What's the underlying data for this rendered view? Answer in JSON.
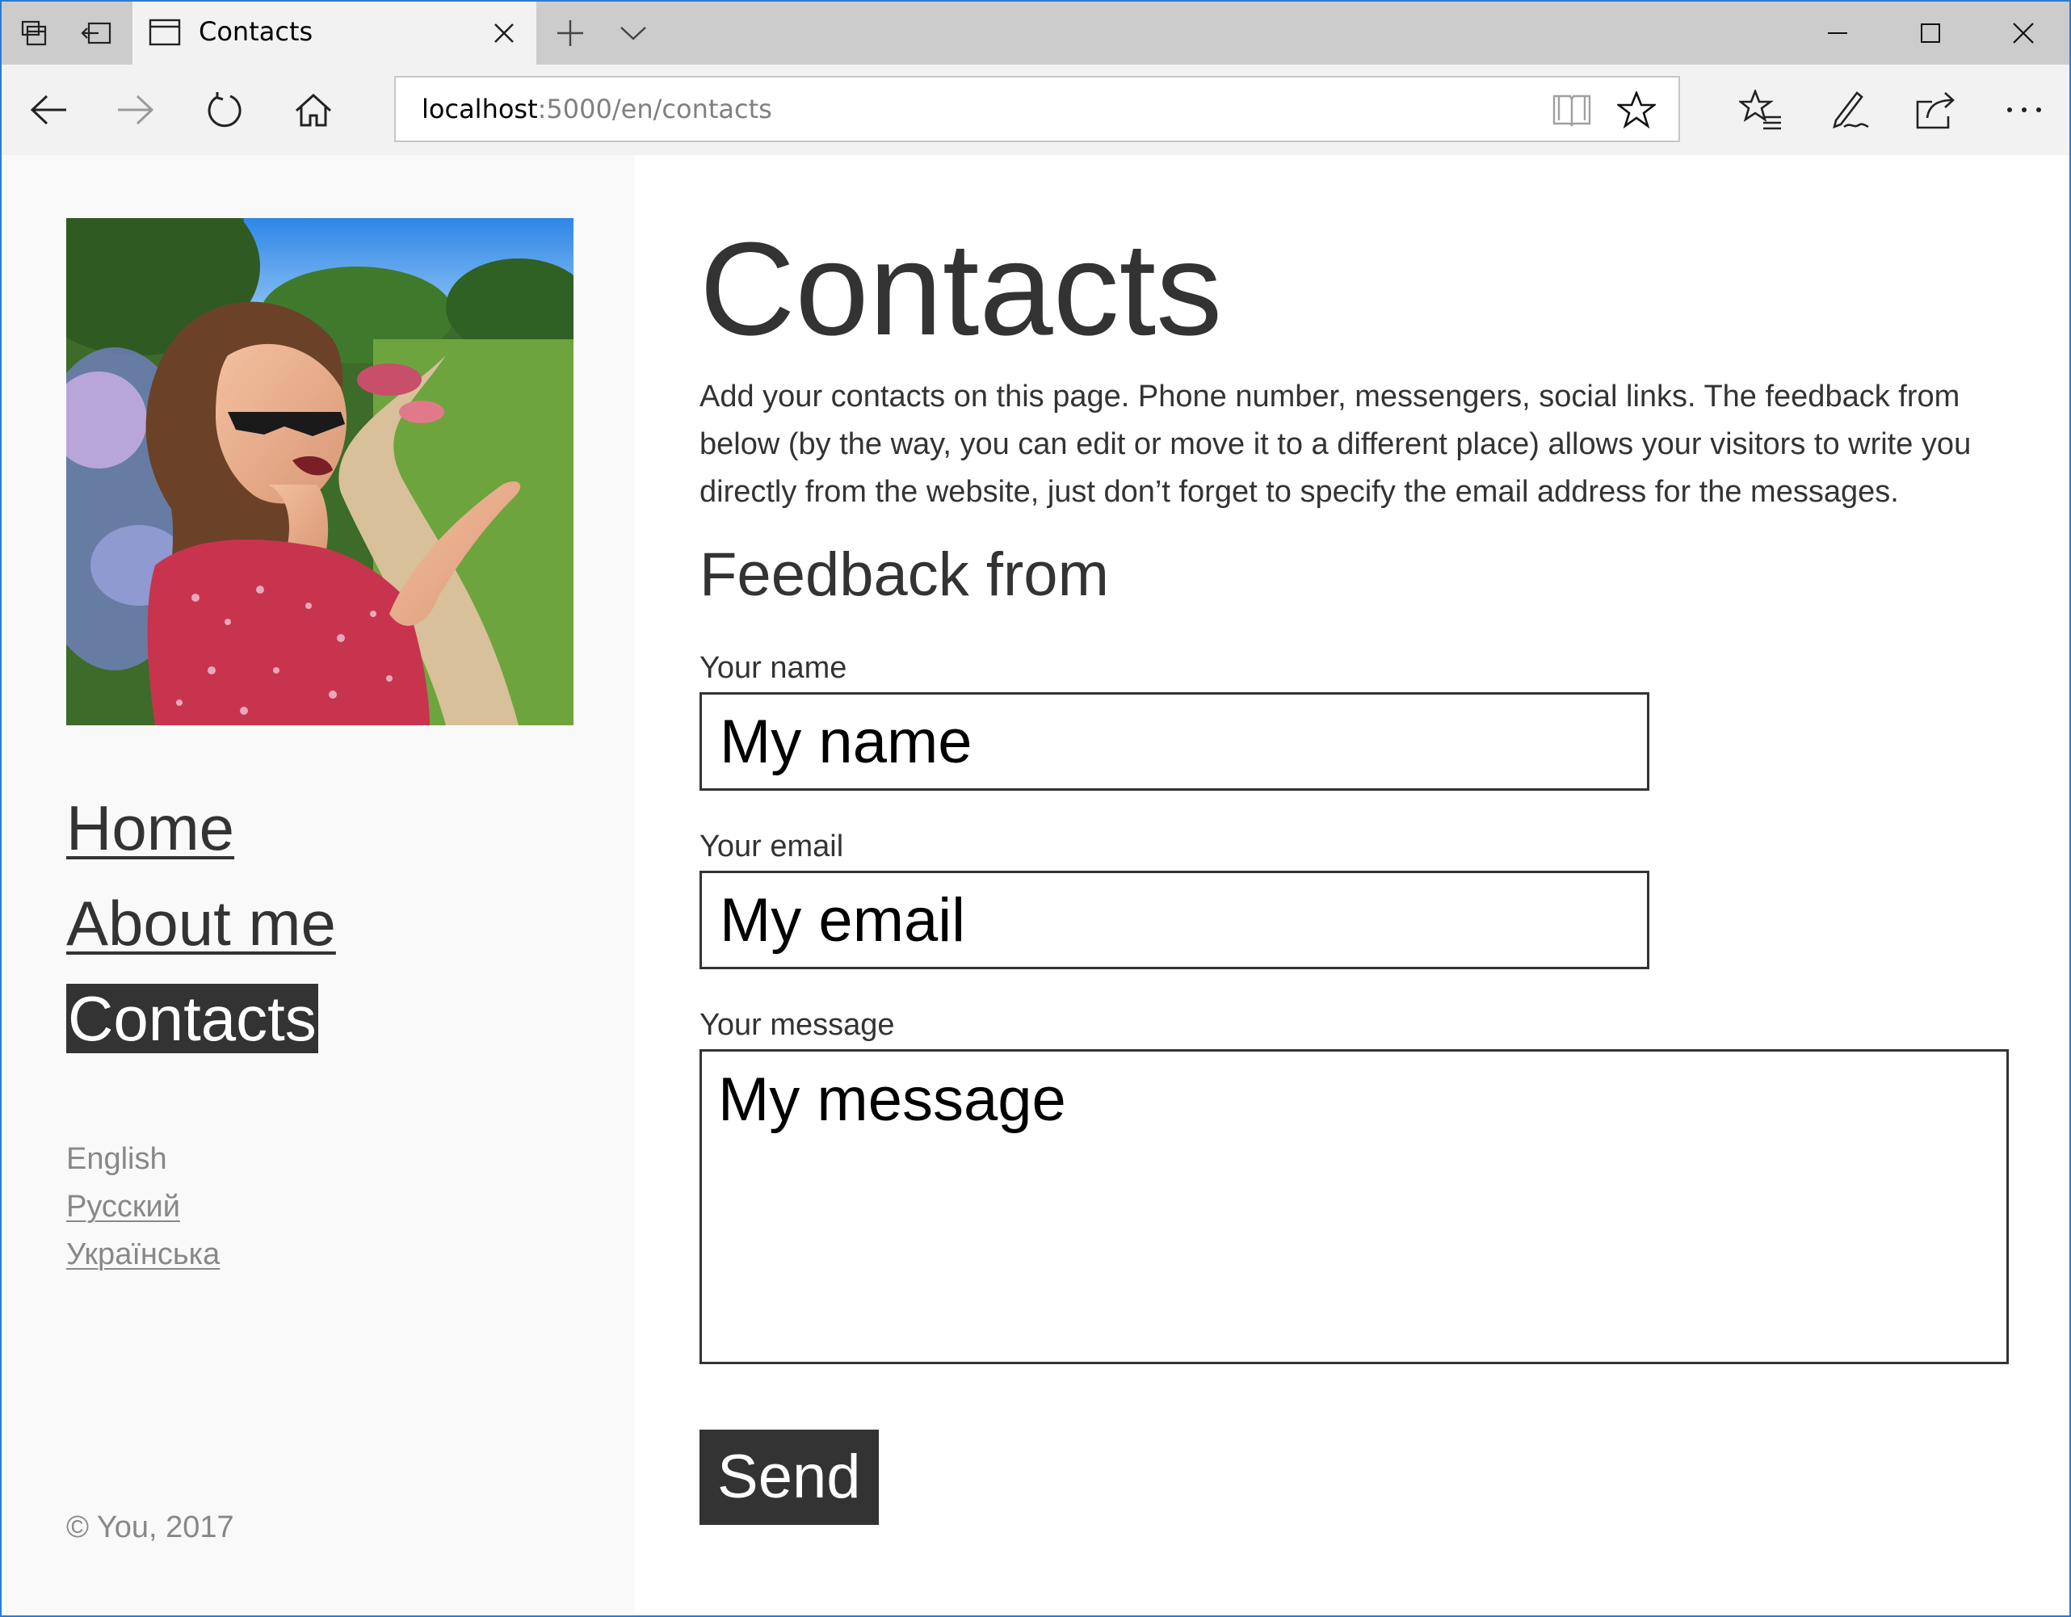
{
  "browser": {
    "tab_title": "Contacts",
    "url_host": "localhost",
    "url_rest": ":5000/en/contacts",
    "icons": {
      "tab_actions": "tab-preview-icon",
      "set_aside": "set-aside-tabs-icon",
      "new_tab": "plus-icon",
      "tab_list": "chevron-down-icon",
      "minimize": "minimize-icon",
      "maximize": "maximize-icon",
      "close": "close-icon",
      "back": "back-arrow-icon",
      "forward": "forward-arrow-icon",
      "refresh": "refresh-icon",
      "home": "home-icon",
      "reading_view": "book-icon",
      "favorite": "star-icon",
      "favorites_hub": "favorites-list-icon",
      "web_note": "pen-icon",
      "share": "share-icon",
      "more": "more-icon"
    }
  },
  "sidebar": {
    "menu": [
      {
        "label": "Home",
        "active": false
      },
      {
        "label": "About me",
        "active": false
      },
      {
        "label": "Contacts",
        "active": true
      }
    ],
    "languages": [
      {
        "label": "English",
        "current": true
      },
      {
        "label": "Русский",
        "current": false
      },
      {
        "label": "Українська",
        "current": false
      }
    ],
    "copyright": "© You, 2017"
  },
  "main": {
    "title": "Contacts",
    "intro": "Add your contacts on this page. Phone number, messengers, social links. The feedback from below (by the way, you can edit or move it to a different place) allows your visitors to write you directly from the website, just don’t forget to specify the email address for the messages.",
    "form_title": "Feedback from",
    "name_label": "Your name",
    "name_placeholder": "My name",
    "email_label": "Your email",
    "email_placeholder": "My email",
    "message_label": "Your message",
    "message_placeholder": "My message",
    "send_label": "Send"
  },
  "colors": {
    "accent_dark": "#333333",
    "sidebar_bg": "#f9f9f9",
    "muted_text": "#888888",
    "window_border": "#2b7bd3",
    "titlebar_bg": "#cccccc"
  }
}
